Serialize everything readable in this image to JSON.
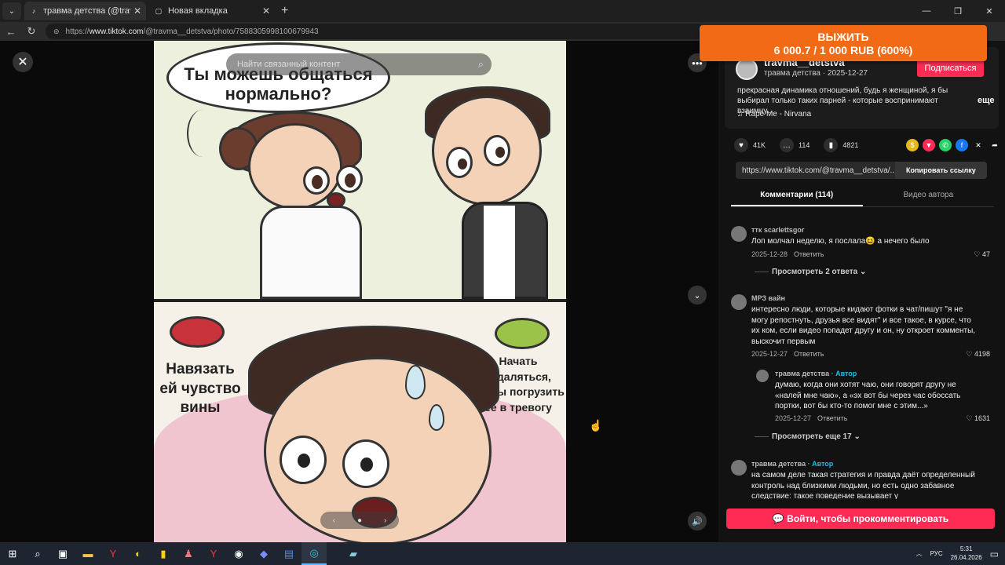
{
  "browser": {
    "tabs": [
      {
        "title": "травма детства (@travma__detstva",
        "favicon": "tiktok-icon"
      },
      {
        "title": "Новая вкладка",
        "favicon": "newtab-icon"
      }
    ],
    "url_prefix": "https://",
    "url_host": "www.tiktok.com",
    "url_path": "/@travma__detstva/photo/7588305998100679943"
  },
  "promo": {
    "line1": "ВЫЖИТЬ",
    "line2": "6 000.7 / 1 000 RUB (600%)",
    "color": "#f26a16"
  },
  "image": {
    "search_placeholder": "Найти связанный контент",
    "bubble_text": "Ты можешь общаться нормально?",
    "left_label": "Навязать ей чувство вины",
    "right_label": "Начать отдаляться, чтобы погрузить ее в тревогу"
  },
  "post": {
    "username": "travma__detstva",
    "display_and_date": "травма детства · 2025-12-27",
    "follow_label": "Подписаться",
    "description": "прекрасная динамика отношений, будь я женщиной, я бы выбирал только таких парней - которые воспринимают взаимну...",
    "more_label": "еще",
    "music": "Rape Me - Nirvana",
    "likes": "41K",
    "comments": "114",
    "saves": "4821",
    "link_text": "https://www.tiktok.com/@travma__detstva/...",
    "copy_label": "Копировать ссылку",
    "accent": "#fe2c55"
  },
  "tabs": {
    "comments": "Комментарии (114)",
    "author_videos": "Видео автора"
  },
  "comments": [
    {
      "name": "ттк scarlettsgor",
      "author": "",
      "text": "Лоп молчал неделю, я послала😆 а нечего было",
      "date": "2025-12-28",
      "reply": "Ответить",
      "likes": "47",
      "view": "Просмотреть 2 ответа"
    },
    {
      "name": "МРЗ вайн",
      "author": "",
      "text": "интересно люди, которые кидают фотки в чат/пишут \"я не могу репостнуть, друзья все видят\" и все такое, в курсе, что их ком, если видео попадет другу и он, ну откроет комменты, выскочит первым",
      "date": "2025-12-27",
      "reply": "Ответить",
      "likes": "4198",
      "view": ""
    },
    {
      "name": "травма детства",
      "author": "· Автор",
      "text": "думаю, когда они хотят чаю, они говорят другу не «налей мне чаю», а «эх вот бы через час обоссать портки, вот бы кто-то помог мне с этим...»",
      "date": "2025-12-27",
      "reply": "Ответить",
      "likes": "1631",
      "view": "Просмотреть еще 17"
    },
    {
      "name": "травма детства",
      "author": "· Автор",
      "text": "на самом деле такая стратегия и правда даёт определенный контроль над близкими людьми, но есть одно забавное следствие: такое поведение вызывает у",
      "date": "",
      "reply": "",
      "likes": "",
      "view": ""
    }
  ],
  "login_label": "Войти, чтобы прокомментировать",
  "tray": {
    "lang": "РУС",
    "time": "5:31",
    "date": "26.04.2026"
  }
}
